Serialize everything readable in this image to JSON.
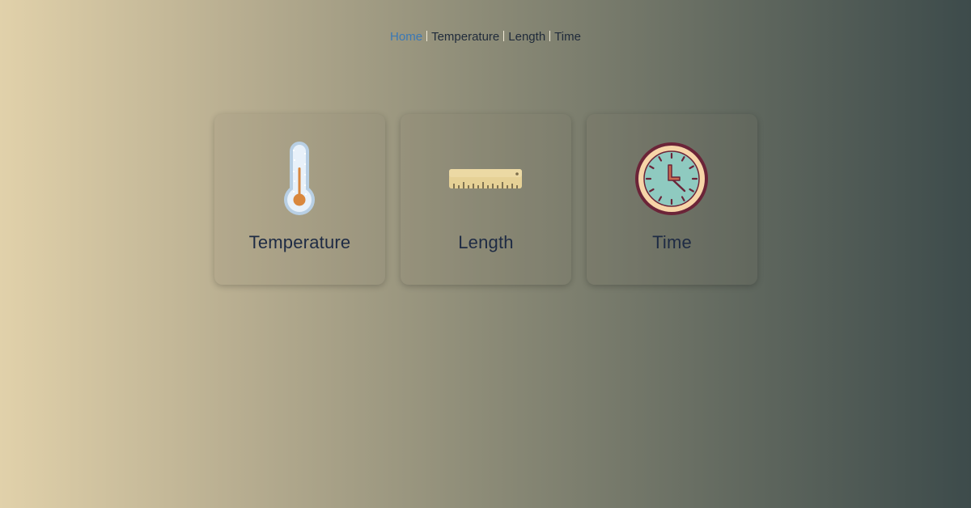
{
  "nav": {
    "items": [
      {
        "label": "Home",
        "active": true
      },
      {
        "label": "Temperature",
        "active": false
      },
      {
        "label": "Length",
        "active": false
      },
      {
        "label": "Time",
        "active": false
      }
    ]
  },
  "cards": [
    {
      "label": "Temperature",
      "icon": "thermometer-icon"
    },
    {
      "label": "Length",
      "icon": "ruler-icon"
    },
    {
      "label": "Time",
      "icon": "clock-icon"
    }
  ],
  "colors": {
    "gradient_start": "#e1d1aa",
    "gradient_end": "#3d4b4b",
    "active_link": "#3a78b5",
    "text": "#1e2b44"
  }
}
